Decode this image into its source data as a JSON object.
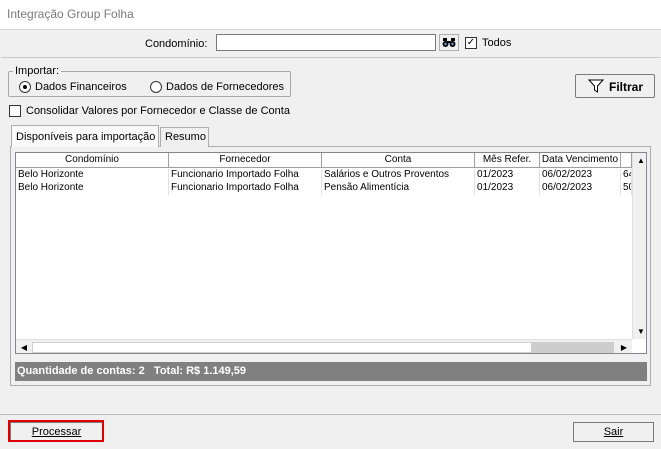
{
  "window": {
    "title": "Integração Group Folha"
  },
  "condominio": {
    "label": "Condomínio:",
    "value": "",
    "search_icon": "binoculars-icon"
  },
  "todos": {
    "label": "Todos",
    "checked": true
  },
  "importar": {
    "legend": "Importar:",
    "options": [
      {
        "label": "Dados Financeiros",
        "selected": true
      },
      {
        "label": "Dados de Fornecedores",
        "selected": false
      }
    ]
  },
  "filtrar": {
    "label": "Filtrar",
    "icon": "funnel-icon"
  },
  "consolidar": {
    "label": "Consolidar Valores por Fornecedor e Classe de Conta",
    "checked": false
  },
  "tabs": [
    {
      "label": "Disponíveis para importação",
      "active": true
    },
    {
      "label": "Resumo",
      "active": false
    }
  ],
  "grid": {
    "columns": [
      "Condomínio",
      "Fornecedor",
      "Conta",
      "Mês Refer.",
      "Data Vencimento",
      ""
    ],
    "rows": [
      [
        "Belo Horizonte",
        "Funcionario Importado Folha",
        "Salários e Outros Proventos",
        "01/2023",
        "06/02/2023",
        "64"
      ],
      [
        "Belo Horizonte",
        "Funcionario Importado Folha",
        "Pensão Alimentícia",
        "01/2023",
        "06/02/2023",
        "50"
      ]
    ]
  },
  "summary": {
    "text": "Quantidade de contas: 2   Total: R$ 1.149,59"
  },
  "buttons": {
    "processar": "Processar",
    "sair": "Sair"
  },
  "colors": {
    "highlight": "#e00000",
    "summary_bg": "#808080"
  }
}
